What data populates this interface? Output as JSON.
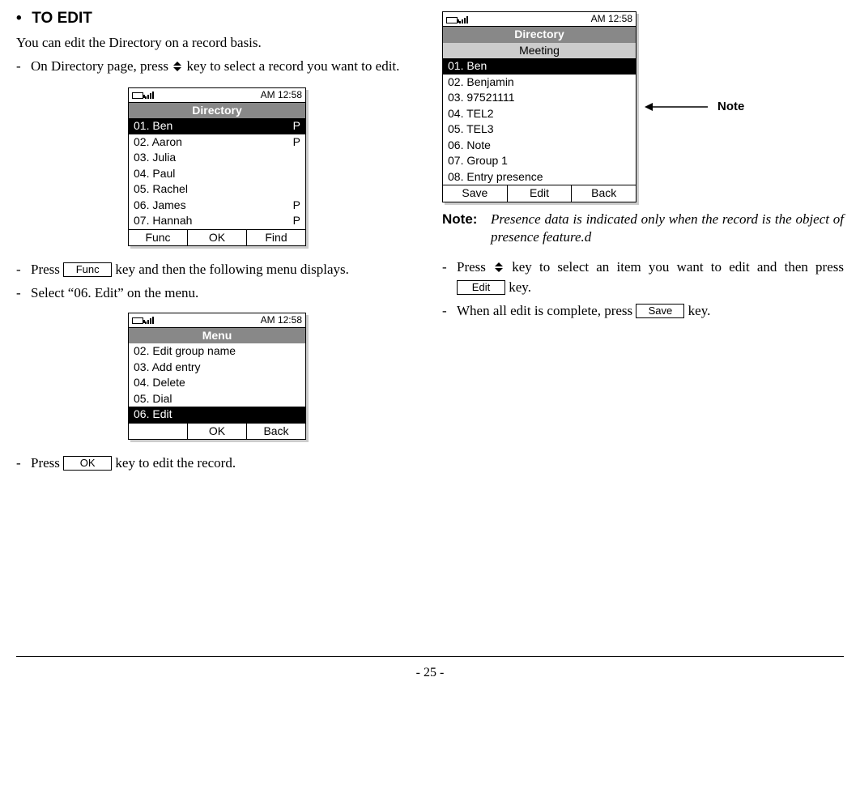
{
  "section": {
    "title": "TO EDIT"
  },
  "intro": "You can edit the Directory on a record basis.",
  "steps_left": {
    "s1a": "On Directory page, press ",
    "s1b": " key to select a record you want to edit.",
    "s2a": "Press ",
    "s2b": " key and then the following menu displays.",
    "s3": "Select “06. Edit” on the menu.",
    "s4a": "Press ",
    "s4b": " key to edit the record."
  },
  "key_labels": {
    "func": "Func",
    "ok": "OK",
    "edit": "Edit",
    "save": "Save"
  },
  "screen1": {
    "time": "AM 12:58",
    "title": "Directory",
    "rows": [
      {
        "t": "01. Ben",
        "p": "P",
        "sel": true
      },
      {
        "t": "02. Aaron",
        "p": "P",
        "sel": false
      },
      {
        "t": "03. Julia",
        "p": "",
        "sel": false
      },
      {
        "t": "04. Paul",
        "p": "",
        "sel": false
      },
      {
        "t": "05. Rachel",
        "p": "",
        "sel": false
      },
      {
        "t": "06. James",
        "p": "P",
        "sel": false
      },
      {
        "t": "07. Hannah",
        "p": "P",
        "sel": false
      }
    ],
    "sk": [
      "Func",
      "OK",
      "Find"
    ]
  },
  "screen2": {
    "time": "AM 12:58",
    "title": "Menu",
    "rows": [
      {
        "t": "02. Edit group name",
        "sel": false
      },
      {
        "t": "03. Add entry",
        "sel": false
      },
      {
        "t": "04. Delete",
        "sel": false
      },
      {
        "t": "05. Dial",
        "sel": false
      },
      {
        "t": "06. Edit",
        "sel": true
      }
    ],
    "sk": [
      "",
      "OK",
      "Back"
    ]
  },
  "screen3": {
    "time": "AM 12:58",
    "title": "Directory",
    "subtitle": "Meeting",
    "rows": [
      {
        "t": "01. Ben",
        "sel": true
      },
      {
        "t": "02. Benjamin",
        "sel": false
      },
      {
        "t": "03. 97521111",
        "sel": false
      },
      {
        "t": "04. TEL2",
        "sel": false
      },
      {
        "t": "05. TEL3",
        "sel": false
      },
      {
        "t": "06. Note",
        "sel": false
      },
      {
        "t": "07. Group 1",
        "sel": false
      },
      {
        "t": "08. Entry presence",
        "sel": false
      }
    ],
    "sk": [
      "Save",
      "Edit",
      "Back"
    ]
  },
  "callout": "Note",
  "note": {
    "label": "Note:",
    "text": "Presence data is indicated only when the record is the object of presence feature.d"
  },
  "steps_right": {
    "s1a": "Press ",
    "s1b": " key to select an item you want to edit and then press ",
    "s1c": " key.",
    "s2a": "When all edit is complete, press ",
    "s2b": " key."
  },
  "page_number": "- 25 -"
}
